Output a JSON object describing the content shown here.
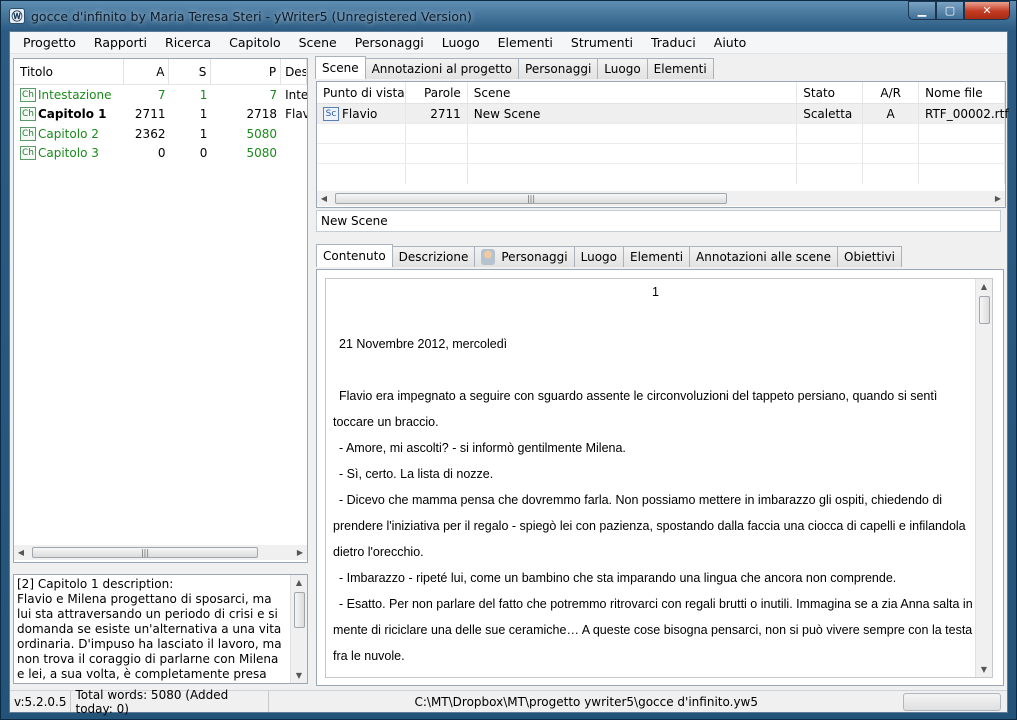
{
  "window": {
    "title": "gocce d'infinito by Maria Teresa Steri - yWriter5 (Unregistered Version)",
    "controls": {
      "minimize": "▁",
      "maximize": "▢",
      "close": "✕"
    }
  },
  "menu": [
    "Progetto",
    "Rapporti",
    "Ricerca",
    "Capitolo",
    "Scene",
    "Personaggi",
    "Luogo",
    "Elementi",
    "Strumenti",
    "Traduci",
    "Aiuto"
  ],
  "chapters": {
    "headers": {
      "title": "Titolo",
      "a": "A",
      "s": "S",
      "p": "P",
      "desc": "Des"
    },
    "icon_text": "Ch",
    "rows": [
      {
        "title": "Intestazione",
        "a": "7",
        "s": "1",
        "p": "7",
        "desc": "Inte"
      },
      {
        "title": "Capitolo 1",
        "a": "2711",
        "s": "1",
        "p": "2718",
        "desc": "Flav"
      },
      {
        "title": "Capitolo 2",
        "a": "2362",
        "s": "1",
        "p": "5080",
        "desc": ""
      },
      {
        "title": "Capitolo 3",
        "a": "0",
        "s": "0",
        "p": "5080",
        "desc": ""
      }
    ]
  },
  "scrollbar_glyph": "|||",
  "description": {
    "heading": "[2] Capitolo 1 description:",
    "text": "Flavio e Milena progettano di sposarci, ma lui sta attraversando un periodo di crisi e si domanda se esiste un'alternativa a una vita ordinaria. D'impuso ha lasciato il lavoro, ma non trova il coraggio di parlarne con Milena e lei, a sua volta, è completamente presa dai preparativi per le nozze."
  },
  "top_tabs": [
    "Scene",
    "Annotazioni al progetto",
    "Personaggi",
    "Luogo",
    "Elementi"
  ],
  "scenes": {
    "headers": {
      "pov": "Punto di vista",
      "words": "Parole",
      "scene": "Scene",
      "state": "Stato",
      "ar": "A/R",
      "file": "Nome file"
    },
    "icon_text": "Sc",
    "rows": [
      {
        "pov": "Flavio",
        "words": "2711",
        "scene": "New Scene",
        "state": "Scaletta",
        "ar": "A",
        "file": "RTF_00002.rtf"
      }
    ]
  },
  "scene_name": "New Scene",
  "bottom_tabs": [
    "Contenuto",
    "Descrizione",
    "Personaggi",
    "Luogo",
    "Elementi",
    "Annotazioni alle scene",
    "Obiettivi"
  ],
  "content": {
    "page_number": "1",
    "paragraphs": [
      "21 Novembre 2012, mercoledì",
      "Flavio era impegnato a seguire con sguardo assente le circonvoluzioni del tappeto persiano, quando si sentì toccare un braccio.",
      "- Amore, mi ascolti? - si informò gentilmente Milena.",
      "- Sì, certo. La lista di nozze.",
      "- Dicevo che mamma pensa che dovremmo farla. Non possiamo mettere in imbarazzo gli ospiti, chiedendo di prendere l'iniziativa per il regalo - spiegò lei con pazienza, spostando dalla faccia una ciocca di capelli e infilandola dietro l'orecchio.",
      "- Imbarazzo - ripeté lui, come un bambino che sta imparando una lingua che ancora non comprende.",
      "- Esatto. Per non parlare del fatto che potremmo ritrovarci con regali brutti o inutili. Immagina se a zia Anna salta in mente di riciclare una delle sue ceramiche… A queste cose bisogna pensarci, non si può vivere sempre con la testa fra le nuvole."
    ]
  },
  "status": {
    "version": "v:5.2.0.5",
    "words": "Total words: 5080 (Added today: 0)",
    "path": "C:\\MT\\Dropbox\\MT\\progetto ywriter5\\gocce d'infinito.yw5"
  }
}
